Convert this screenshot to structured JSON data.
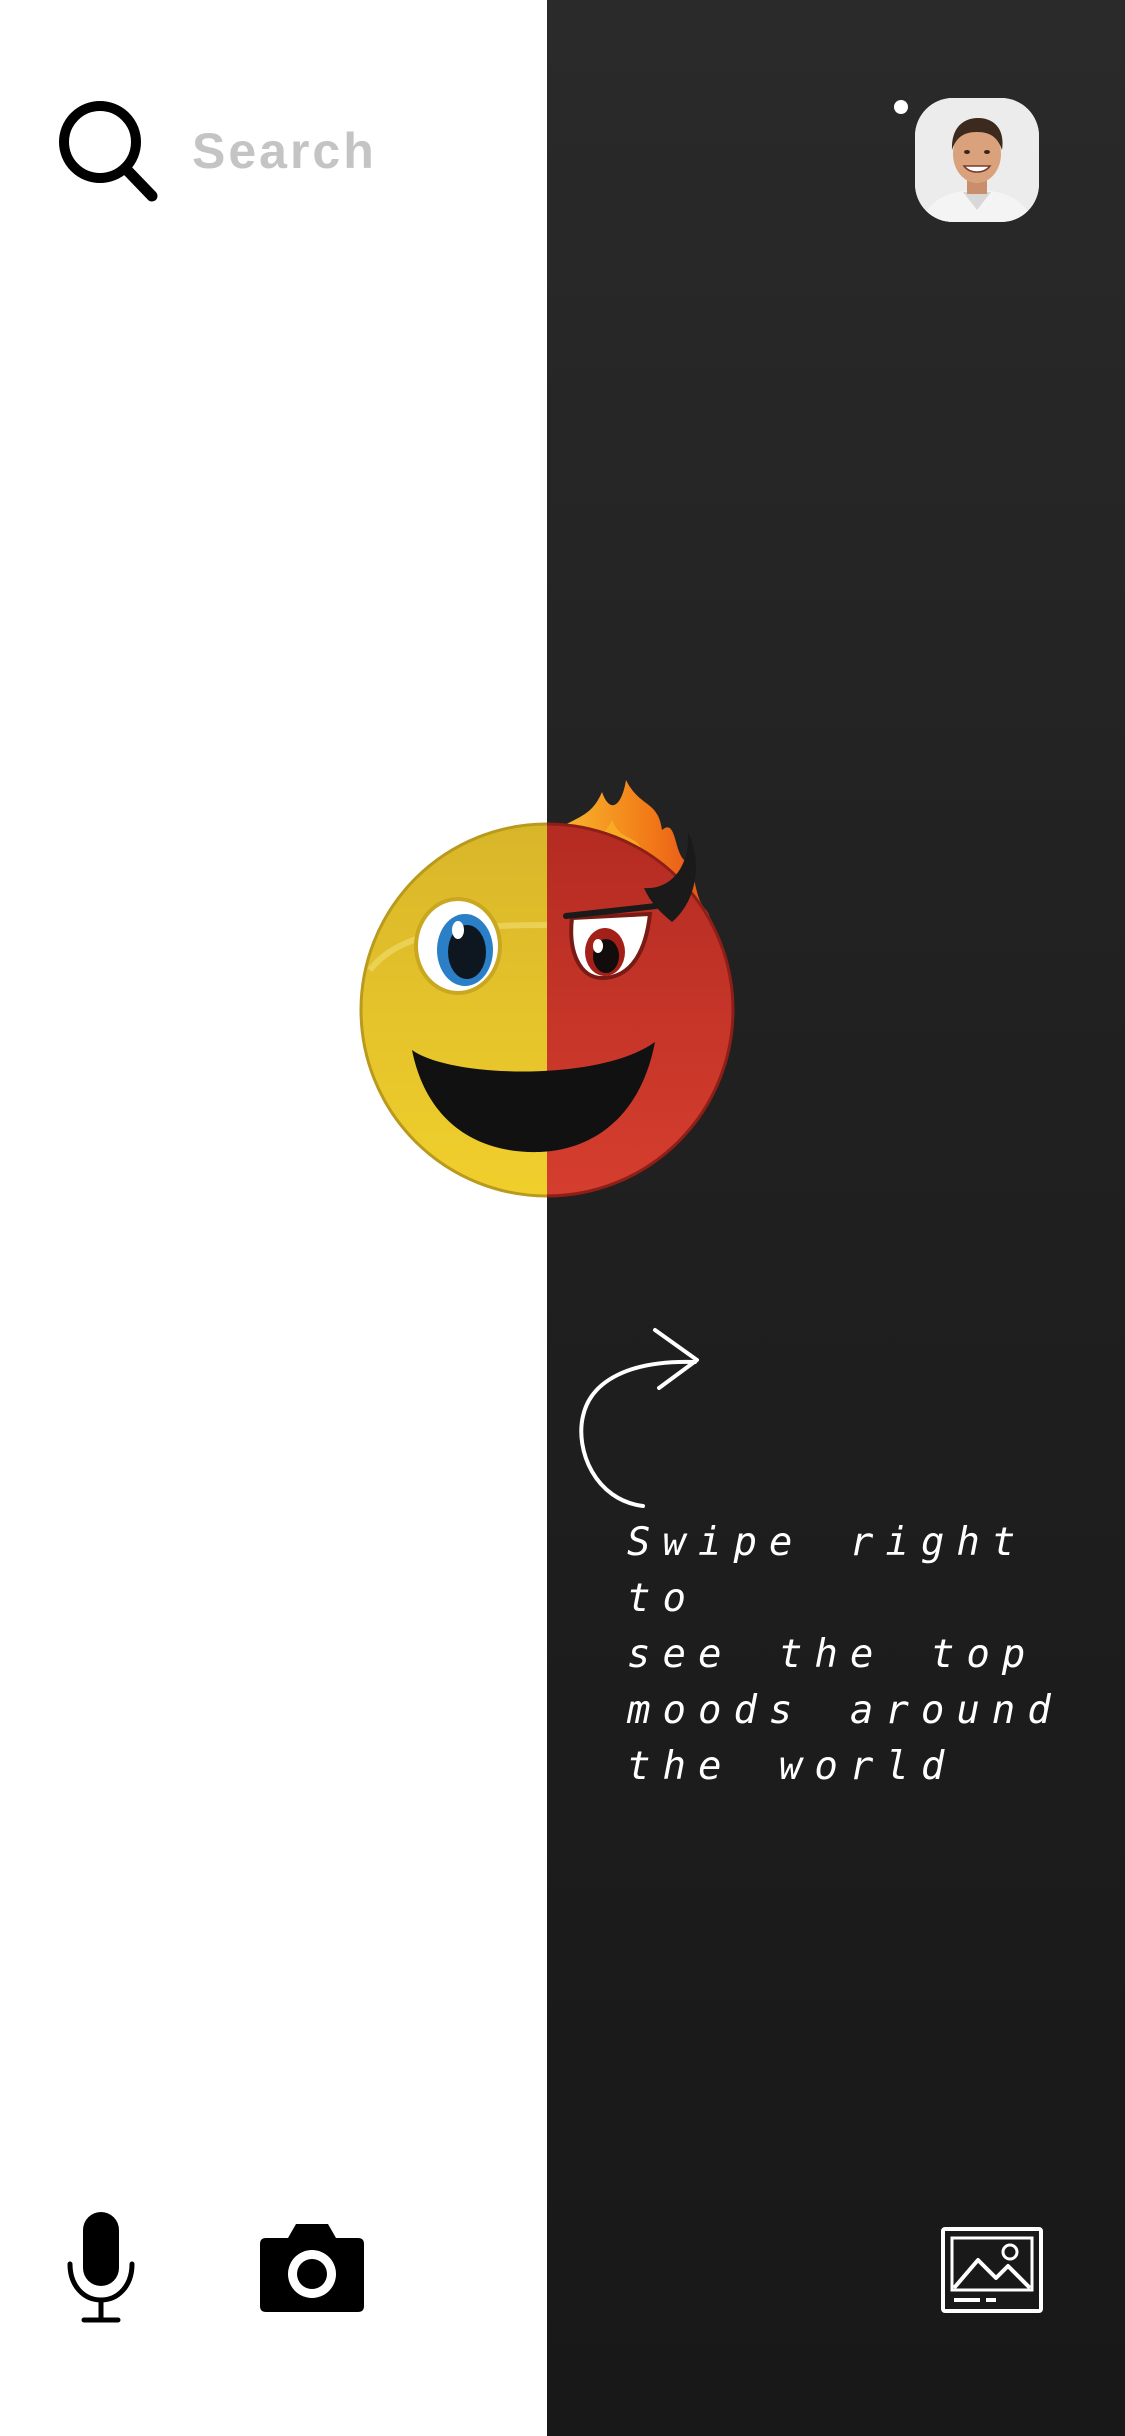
{
  "search": {
    "placeholder": "Search"
  },
  "profile": {
    "has_notification": true
  },
  "hint": {
    "text": "Swipe right to\nsee the top\nmoods around\nthe world"
  },
  "icons": {
    "search": "search-icon",
    "avatar": "profile-avatar",
    "notification": "notification-dot",
    "emoji": "happy-devil-emoji",
    "arrow": "curved-arrow-icon",
    "mic": "microphone-icon",
    "camera": "camera-icon",
    "gallery": "gallery-icon"
  },
  "colors": {
    "light_panel": "#ffffff",
    "dark_panel": "#202020",
    "placeholder_text": "#c4c4c4",
    "happy_face": "#e8c52a",
    "devil_face": "#c43327",
    "flame": "#f47a1c"
  }
}
